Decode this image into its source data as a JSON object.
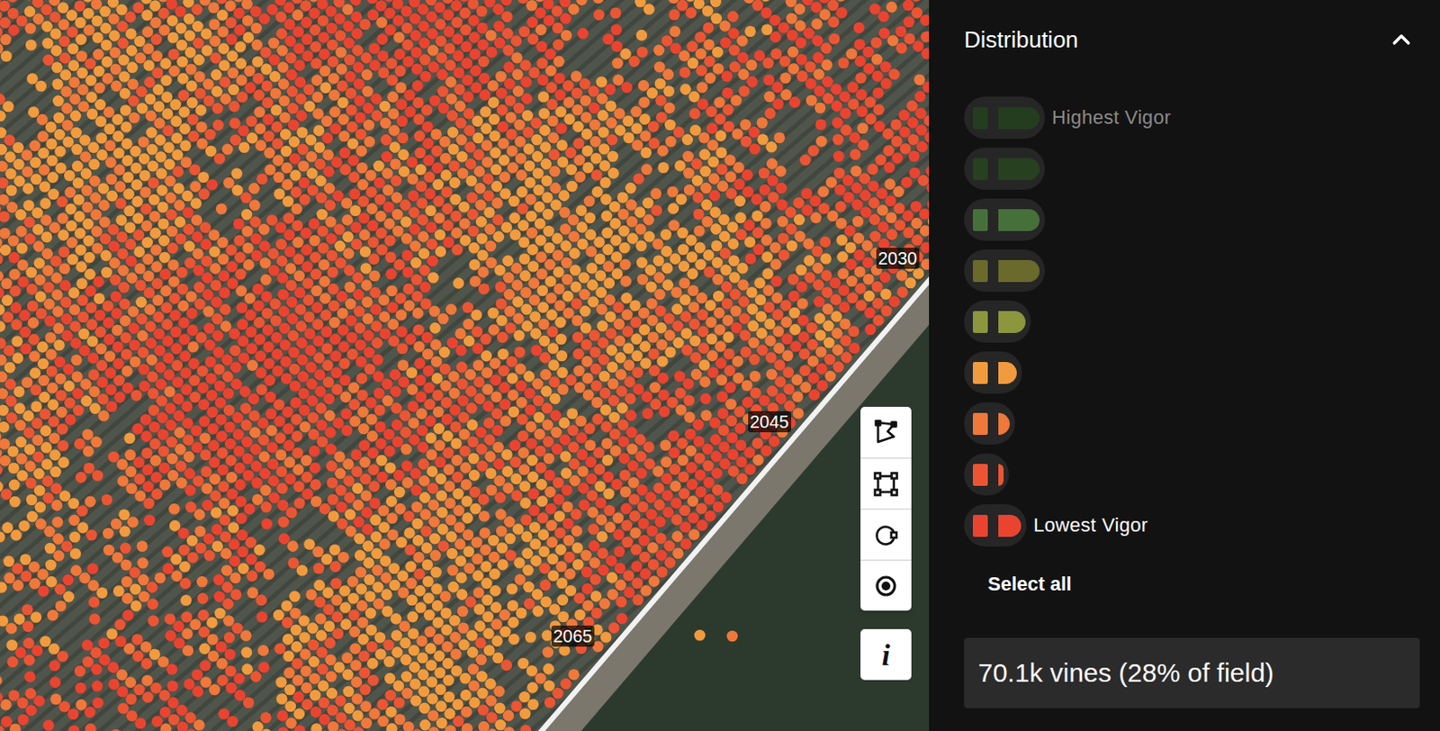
{
  "panel": {
    "title": "Distribution"
  },
  "legend": [
    {
      "label": "Highest Vigor",
      "selected": false,
      "level": 1.0,
      "color": "#243d1f"
    },
    {
      "label": "",
      "selected": false,
      "level": 1.0,
      "color": "#27401f"
    },
    {
      "label": "",
      "selected": false,
      "level": 1.0,
      "color": "#46703a"
    },
    {
      "label": "",
      "selected": false,
      "level": 1.0,
      "color": "#6a6a2c"
    },
    {
      "label": "",
      "selected": false,
      "level": 0.65,
      "color": "#8c963d"
    },
    {
      "label": "",
      "selected": true,
      "level": 0.44,
      "color": "#f29b3e"
    },
    {
      "label": "",
      "selected": true,
      "level": 0.27,
      "color": "#f0783a"
    },
    {
      "label": "",
      "selected": true,
      "level": 0.12,
      "color": "#ec5533"
    },
    {
      "label": "Lowest Vigor",
      "selected": true,
      "level": 0.55,
      "color": "#ea4430"
    }
  ],
  "select_all": "Select all",
  "summary": "70.1k vines (28% of field)",
  "map": {
    "labels": [
      {
        "text": "2030"
      },
      {
        "text": "2045"
      },
      {
        "text": "2065"
      }
    ]
  },
  "toolbar": {
    "info": "i"
  }
}
